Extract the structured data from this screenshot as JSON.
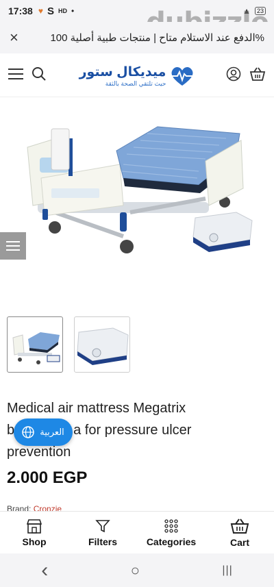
{
  "status_bar": {
    "time": "17:38",
    "icons_left": [
      "♥",
      "S",
      "HD",
      "•"
    ],
    "signal": "▲",
    "battery": "23"
  },
  "watermark": "dubizzle",
  "announcement": {
    "text": "%الدفع عند الاستلام متاح | منتجات طبية أصلية 100",
    "close": "×"
  },
  "header": {
    "logo_name": "ميديكال ستور",
    "logo_tagline": "حيث تلتقي الصحة بالثقة",
    "icons": [
      "menu-icon",
      "search-icon",
      "user-icon",
      "cart-icon"
    ]
  },
  "product": {
    "title": "Medical air mattress Megatrix brand Stella for pressure ulcer prevention",
    "title_line1": "Medical air mattress Megatrix",
    "title_line2_start": "b",
    "title_line2_end": "a for pressure ulcer",
    "title_line3": "prevention",
    "price": "2.000 EGP",
    "brand_label": "Brand:",
    "brand_value": "Cronzie"
  },
  "language_button": {
    "label": "العربية"
  },
  "bottom_nav": [
    {
      "label": "Shop",
      "icon": "shop-icon"
    },
    {
      "label": "Filters",
      "icon": "filter-icon"
    },
    {
      "label": "Categories",
      "icon": "categories-icon"
    },
    {
      "label": "Cart",
      "icon": "basket-icon"
    }
  ],
  "system_nav": {
    "back": "‹",
    "home": "○",
    "recent": "|||"
  },
  "colors": {
    "accent": "#1e88e5",
    "brand": "#1a4fa3",
    "mattress": "#7fa6d8"
  }
}
